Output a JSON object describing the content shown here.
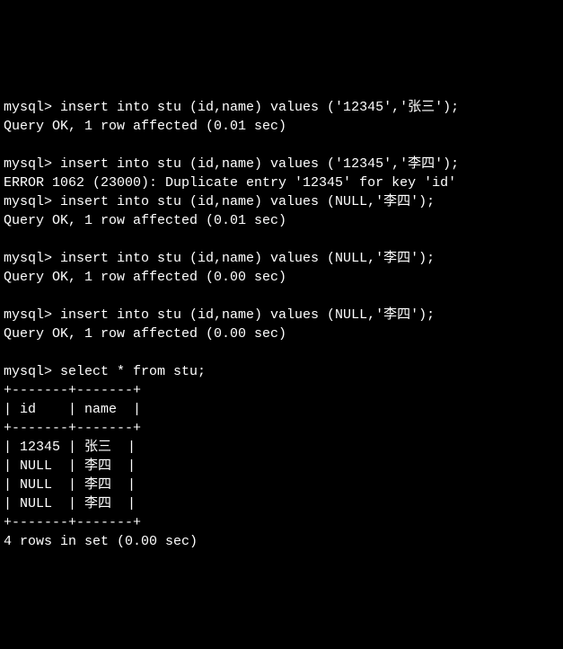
{
  "lines": {
    "l1": "mysql> insert into stu (id,name) values ('12345','张三');",
    "l2": "Query OK, 1 row affected (0.01 sec)",
    "l3": "",
    "l4": "mysql> insert into stu (id,name) values ('12345','李四');",
    "l5": "ERROR 1062 (23000): Duplicate entry '12345' for key 'id'",
    "l6": "mysql> insert into stu (id,name) values (NULL,'李四');",
    "l7": "Query OK, 1 row affected (0.01 sec)",
    "l8": "",
    "l9": "mysql> insert into stu (id,name) values (NULL,'李四');",
    "l10": "Query OK, 1 row affected (0.00 sec)",
    "l11": "",
    "l12": "mysql> insert into stu (id,name) values (NULL,'李四');",
    "l13": "Query OK, 1 row affected (0.00 sec)",
    "l14": "",
    "l15": "mysql> select * from stu;",
    "l16": "+-------+-------+",
    "l17": "| id    | name  |",
    "l18": "+-------+-------+",
    "l19": "| 12345 | 张三  |",
    "l20": "| NULL  | 李四  |",
    "l21": "| NULL  | 李四  |",
    "l22": "| NULL  | 李四  |",
    "l23": "+-------+-------+",
    "l24": "4 rows in set (0.00 sec)"
  },
  "chart_data": {
    "type": "table",
    "title": "select * from stu",
    "columns": [
      "id",
      "name"
    ],
    "rows": [
      [
        "12345",
        "张三"
      ],
      [
        "NULL",
        "李四"
      ],
      [
        "NULL",
        "李四"
      ],
      [
        "NULL",
        "李四"
      ]
    ],
    "row_count_message": "4 rows in set (0.00 sec)"
  }
}
